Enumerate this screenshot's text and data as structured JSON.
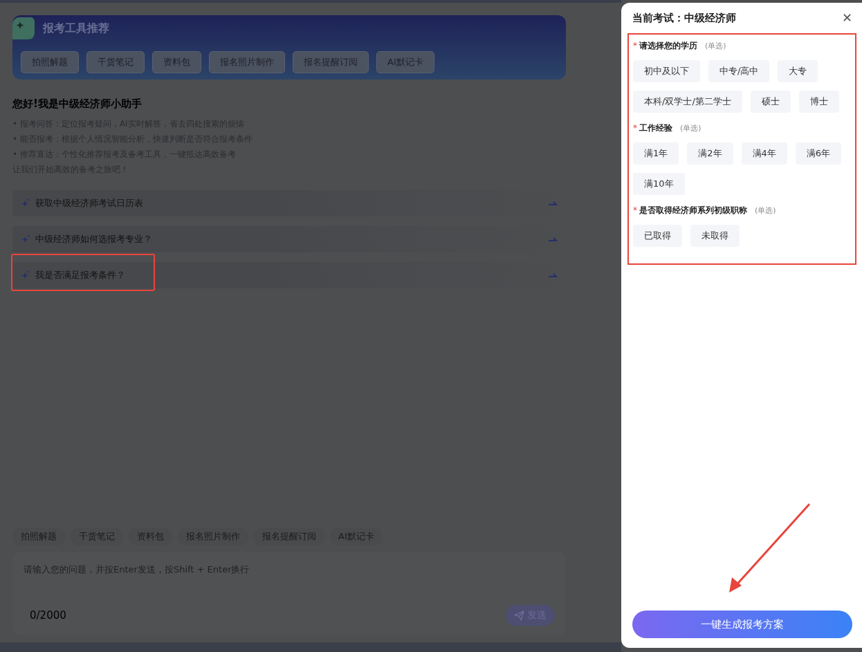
{
  "tools_card": {
    "title": "报考工具推荐",
    "tools": [
      "拍照解题",
      "干货笔记",
      "资料包",
      "报名照片制作",
      "报名提醒订阅",
      "AI默记卡"
    ]
  },
  "greeting": {
    "title": "您好!我是中级经济师小助手",
    "lines": [
      "• 报考问答：定位报考疑问，AI实时解答，省去四处搜索的烦恼",
      "• 能否报考：根据个人情况智能分析，快速判断是否符合报考条件",
      "• 推荐直达：个性化推荐报考及备考工具，一键抵达高效备考",
      "让我们开始高效的备考之旅吧！"
    ]
  },
  "questions": [
    {
      "text": "获取中级经济师考试日历表",
      "highlighted": false
    },
    {
      "text": "中级经济师如何选报考专业？",
      "highlighted": false
    },
    {
      "text": "我是否满足报考条件？",
      "highlighted": true
    }
  ],
  "quick_tools": [
    "拍照解题",
    "干货笔记",
    "资料包",
    "报名照片制作",
    "报名提醒订阅",
    "AI默记卡"
  ],
  "input": {
    "placeholder": "请输入您的问题，并按Enter发送，按Shift + Enter换行",
    "counter": "0/2000",
    "send_label": "发送"
  },
  "panel": {
    "title": "当前考试：中级经济师",
    "close": "✕",
    "highlighted": true,
    "sections": [
      {
        "required_mark": "*",
        "label": "请选择您的学历",
        "hint": "(单选)",
        "options": [
          {
            "label": "初中及以下",
            "selected": false
          },
          {
            "label": "中专/高中",
            "selected": false
          },
          {
            "label": "大专",
            "selected": false
          },
          {
            "label": "本科/双学士/第二学士",
            "selected": false
          },
          {
            "label": "硕士",
            "selected": false
          },
          {
            "label": "博士",
            "selected": false
          }
        ]
      },
      {
        "required_mark": "*",
        "label": "工作经验",
        "hint": "(单选)",
        "options": [
          {
            "label": "满1年",
            "selected": false
          },
          {
            "label": "满2年",
            "selected": false
          },
          {
            "label": "满4年",
            "selected": false
          },
          {
            "label": "满6年",
            "selected": false
          },
          {
            "label": "满10年",
            "selected": false
          }
        ]
      },
      {
        "required_mark": "*",
        "label": "是否取得经济师系列初级职称",
        "hint": "(单选)",
        "options": [
          {
            "label": "已取得",
            "selected": false
          },
          {
            "label": "未取得",
            "selected": false
          }
        ]
      }
    ],
    "submit": "一键生成报考方案",
    "arrow_annotation": true
  }
}
